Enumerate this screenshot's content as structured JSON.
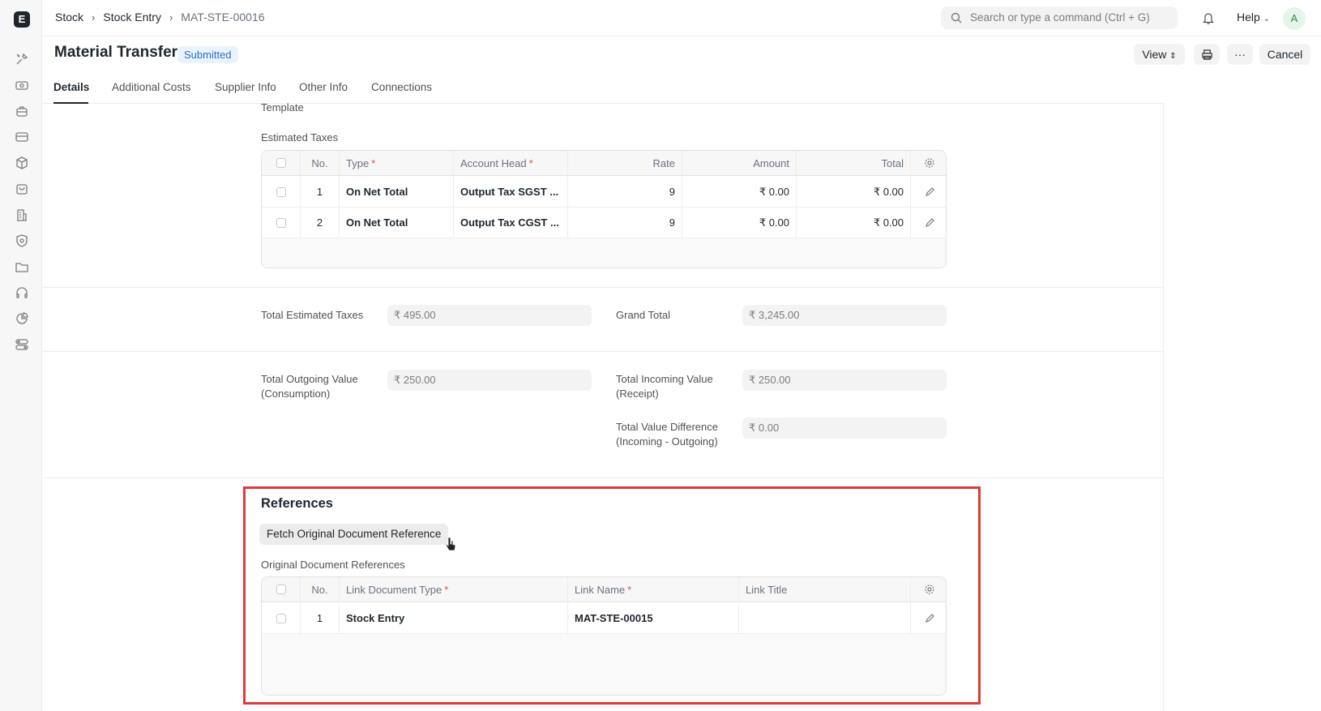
{
  "topbar": {
    "breadcrumb": [
      "Stock",
      "Stock Entry",
      "MAT-STE-00016"
    ],
    "search_placeholder": "Search or type a command (Ctrl + G)",
    "help_label": "Help",
    "avatar_initial": "A"
  },
  "sidebar": {
    "logo": "E",
    "icons": [
      "tools-icon",
      "money-icon",
      "briefcase-icon",
      "card-icon",
      "box-icon",
      "shopping-bag-icon",
      "building-icon",
      "shield-icon",
      "folder-icon",
      "headset-icon",
      "pie-chart-icon",
      "toggle-icon"
    ]
  },
  "page": {
    "title": "Material Transfer",
    "status": "Submitted",
    "view_label": "View",
    "more_label": "···",
    "cancel_label": "Cancel"
  },
  "tabs": [
    "Details",
    "Additional Costs",
    "Supplier Info",
    "Other Info",
    "Connections"
  ],
  "taxes": {
    "template_label": "Template",
    "section_label": "Estimated Taxes",
    "headers": {
      "no": "No.",
      "type": "Type",
      "account_head": "Account Head",
      "rate": "Rate",
      "amount": "Amount",
      "total": "Total"
    },
    "rows": [
      {
        "no": "1",
        "type": "On Net Total",
        "account_head": "Output Tax SGST ...",
        "rate": "9",
        "amount": "₹ 0.00",
        "total": "₹ 0.00"
      },
      {
        "no": "2",
        "type": "On Net Total",
        "account_head": "Output Tax CGST ...",
        "rate": "9",
        "amount": "₹ 0.00",
        "total": "₹ 0.00"
      }
    ]
  },
  "totals": {
    "total_estimated_taxes_label": "Total Estimated Taxes",
    "total_estimated_taxes": "₹ 495.00",
    "grand_total_label": "Grand Total",
    "grand_total": "₹ 3,245.00",
    "outgoing_label_1": "Total Outgoing Value",
    "outgoing_label_2": "(Consumption)",
    "outgoing_value": "₹ 250.00",
    "incoming_label_1": "Total Incoming Value",
    "incoming_label_2": "(Receipt)",
    "incoming_value": "₹ 250.00",
    "difference_label_1": "Total Value Difference",
    "difference_label_2": "(Incoming - Outgoing)",
    "difference_value": "₹ 0.00"
  },
  "references": {
    "title": "References",
    "fetch_button": "Fetch Original Document Reference",
    "table_label": "Original Document References",
    "headers": {
      "no": "No.",
      "link_document_type": "Link Document Type",
      "link_name": "Link Name",
      "link_title": "Link Title"
    },
    "rows": [
      {
        "no": "1",
        "link_document_type": "Stock Entry",
        "link_name": "MAT-STE-00015",
        "link_title": ""
      }
    ]
  },
  "colors": {
    "highlight": "#e03a3a",
    "status_badge": "#2872c6",
    "required": "#e24c4c"
  }
}
